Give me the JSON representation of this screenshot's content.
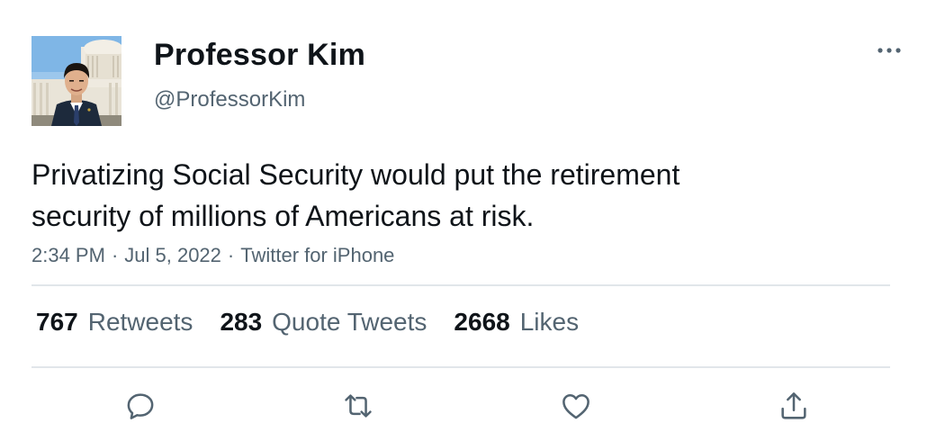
{
  "tweet": {
    "author": {
      "display_name": "Professor Kim",
      "handle": "@ProfessorKim",
      "avatar": "avatar-photo"
    },
    "text_lines": [
      "Privatizing Social Security would put the retirement",
      "security of millions of Americans at risk."
    ],
    "meta": {
      "time": "2:34 PM",
      "separator": "·",
      "date": "Jul 5, 2022",
      "source": "Twitter for iPhone"
    },
    "stats": {
      "retweets_count": "767",
      "retweets_label": "Retweets",
      "quotes_count": "283",
      "quotes_label": "Quote Tweets",
      "likes_count": "2668",
      "likes_label": "Likes"
    },
    "icons": {
      "more": "more-horizontal-icon",
      "reply": "reply-icon",
      "retweet": "retweet-icon",
      "like": "heart-icon",
      "share": "share-icon"
    },
    "colors": {
      "text_primary": "#0f1419",
      "text_secondary": "#536471",
      "divider": "#e1e6ea"
    }
  }
}
